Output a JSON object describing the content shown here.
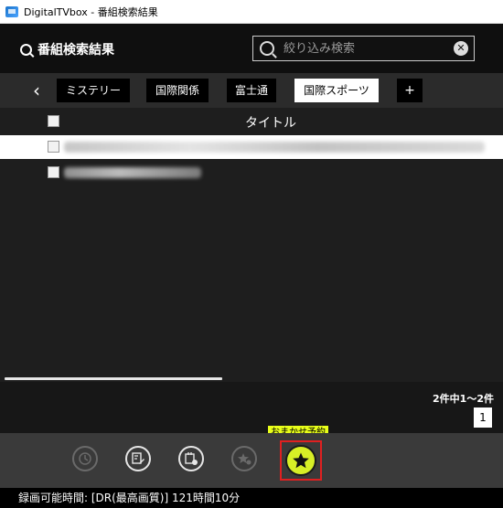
{
  "window": {
    "title": "DigitalTVbox - 番組検索結果"
  },
  "header": {
    "title": "番組検索結果",
    "filter_placeholder": "絞り込み検索"
  },
  "tabs": [
    {
      "label": "ミステリー"
    },
    {
      "label": "国際関係"
    },
    {
      "label": "富士通"
    },
    {
      "label": "国際スポーツ"
    },
    {
      "label": "+"
    }
  ],
  "table": {
    "title_header": "タイトル"
  },
  "pager": {
    "count_text": "2件中1～2件",
    "page_number": "1"
  },
  "toolbar": {
    "tooltip": "おまかせ予約"
  },
  "status": {
    "text": "録画可能時間: [DR(最高画質)] 121時間10分"
  },
  "colors": {
    "accent_highlight": "#d7ef26",
    "selection_box": "#e02020",
    "tooltip_bg": "#e9ff1a"
  },
  "icons": [
    "search-icon",
    "clear-icon",
    "back-chevron-icon",
    "clock-icon",
    "edit-reservation-icon",
    "calendar-icon",
    "star-remove-icon",
    "star-icon"
  ]
}
